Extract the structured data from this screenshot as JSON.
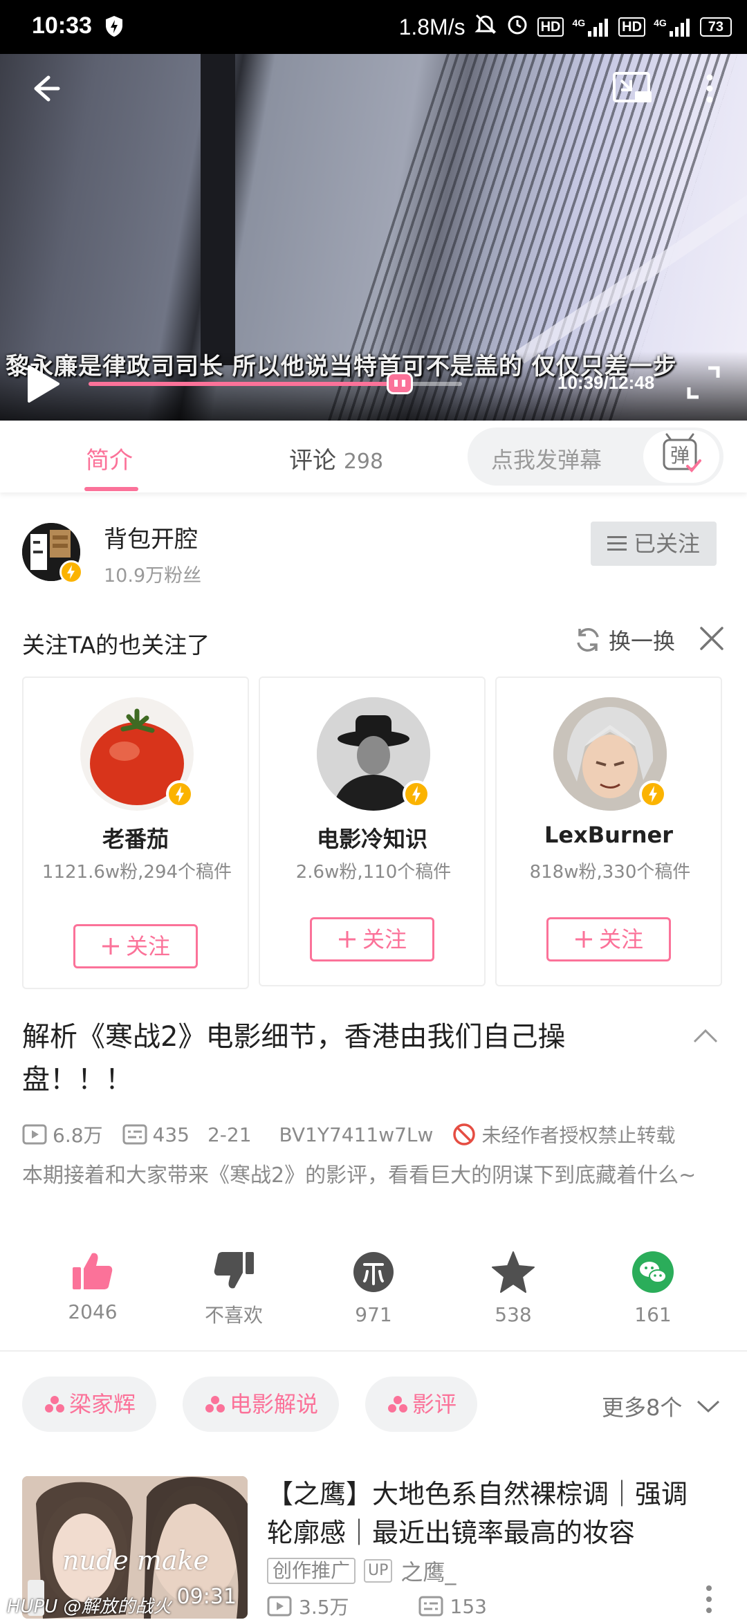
{
  "status_bar": {
    "time": "10:33",
    "net_speed": "1.8M/s",
    "hd1": "HD",
    "sig1": "4G",
    "hd2": "HD",
    "sig2": "4G",
    "battery": "73"
  },
  "player": {
    "subtitle": "黎永廉是律政司司长 所以他说当特首可不是盖的 仅仅只差一步",
    "timecode": "10:39/12:48",
    "progress": 0.833
  },
  "tabs": {
    "intro": "简介",
    "comments": "评论",
    "comments_count": "298",
    "danmu_placeholder": "点我发弹幕",
    "danmu_button": "弹"
  },
  "uploader": {
    "name": "背包开腔",
    "fans": "10.9万粉丝",
    "follow_state": "已关注"
  },
  "recommend": {
    "title": "关注TA的也关注了",
    "refresh": "换一换",
    "cards": [
      {
        "name": "老番茄",
        "stats": "1121.6w粉,294个稿件",
        "button": "关注"
      },
      {
        "name": "电影冷知识",
        "stats": "2.6w粉,110个稿件",
        "button": "关注"
      },
      {
        "name": "LexBurner",
        "stats": "818w粉,330个稿件",
        "button": "关注"
      }
    ]
  },
  "video": {
    "title": "解析《寒战2》电影细节，香港由我们自己操盘！！！",
    "views": "6.8万",
    "danmaku": "435",
    "date": "2-21",
    "bvid": "BV1Y7411w7Lw",
    "copyright": "未经作者授权禁止转载",
    "description": "本期接着和大家带来《寒战2》的影评，看看巨大的阴谋下到底藏着什么~"
  },
  "actions": {
    "like": "2046",
    "dislike": "不喜欢",
    "coin": "971",
    "favorite": "538",
    "share": "161"
  },
  "tags": {
    "items": [
      "梁家辉",
      "电影解说",
      "影评"
    ],
    "more": "更多8个"
  },
  "related": {
    "title": "【之鹰】大地色系自然裸棕调｜强调轮廓感｜最近出镜率最高的妆容",
    "promo_tag": "创作推广",
    "up_badge": "UP",
    "up_name": "之鹰_",
    "duration": "09:31",
    "thumb_text": "nude make",
    "watermark": "HUPU @解放的战火",
    "views": "3.5万",
    "danmaku": "153"
  },
  "colors": {
    "accent": "#fb7299",
    "gold_badge": "#fbb300",
    "wechat": "#2bad5a"
  }
}
